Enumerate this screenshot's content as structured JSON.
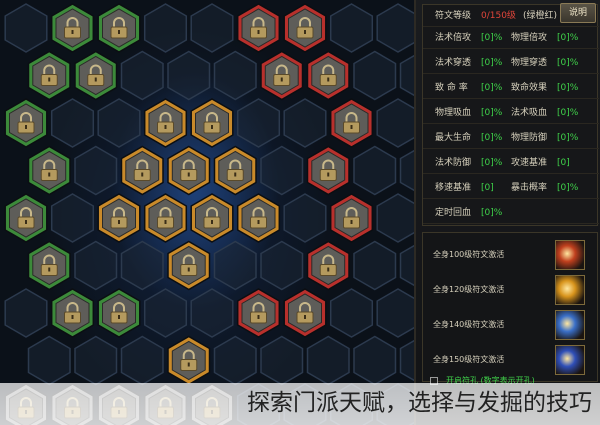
{
  "panel": {
    "help_button": "说明",
    "stats": {
      "header": {
        "label": "符文等级",
        "value": "0/150级",
        "extra": "(绿橙红)"
      },
      "rows": [
        {
          "a_label": "法术倍攻",
          "a_value": "[0]%",
          "b_label": "物理倍攻",
          "b_value": "[0]%"
        },
        {
          "a_label": "法术穿透",
          "a_value": "[0]%",
          "b_label": "物理穿透",
          "b_value": "[0]%"
        },
        {
          "a_label": "致 命 率",
          "a_value": "[0]%",
          "b_label": "致命效果",
          "b_value": "[0]%"
        },
        {
          "a_label": "物理吸血",
          "a_value": "[0]%",
          "b_label": "法术吸血",
          "b_value": "[0]%"
        },
        {
          "a_label": "最大生命",
          "a_value": "[0]%",
          "b_label": "物理防御",
          "b_value": "[0]%"
        },
        {
          "a_label": "法术防御",
          "a_value": "[0]%",
          "b_label": "攻速基准",
          "b_value": "[0]"
        },
        {
          "a_label": "移速基准",
          "a_value": "[0]",
          "b_label": "暴击概率",
          "b_value": "[0]%"
        },
        {
          "a_label": "定时回血",
          "a_value": "[0]%",
          "b_label": "",
          "b_value": ""
        }
      ]
    },
    "activations": [
      {
        "label": "全身100级符文激活",
        "icon": "fire-rune-icon",
        "color": "#c0401e"
      },
      {
        "label": "全身120级符文激活",
        "icon": "flame-rune-icon",
        "color": "#d8941c"
      },
      {
        "label": "全身140级符文激活",
        "icon": "lightning-rune-icon",
        "color": "#3a6fc8"
      },
      {
        "label": "全身150级符文激活",
        "icon": "frost-rune-icon",
        "color": "#2f4fb8"
      }
    ],
    "legend": "开启符孔 (数字表示开孔)"
  },
  "caption": "探索门派天赋，选择与发掘的技巧",
  "board": {
    "colors": {
      "green": "#3c8a3a",
      "red": "#b8302c",
      "gold": "#c98a2a",
      "empty": "#1c2634"
    },
    "locked_slots": [
      {
        "col": 1,
        "row": 0,
        "tier": "green"
      },
      {
        "col": 2,
        "row": 0,
        "tier": "green"
      },
      {
        "col": 5,
        "row": 0,
        "tier": "red"
      },
      {
        "col": 6,
        "row": 0,
        "tier": "red"
      },
      {
        "col": 0,
        "row": 1,
        "tier": "green"
      },
      {
        "col": 1,
        "row": 1,
        "tier": "green"
      },
      {
        "col": 5,
        "row": 1,
        "tier": "red"
      },
      {
        "col": 6,
        "row": 1,
        "tier": "red"
      },
      {
        "col": 0,
        "row": 2,
        "tier": "green"
      },
      {
        "col": 3,
        "row": 2,
        "tier": "gold"
      },
      {
        "col": 4,
        "row": 2,
        "tier": "gold"
      },
      {
        "col": 7,
        "row": 2,
        "tier": "red"
      },
      {
        "col": 0,
        "row": 3,
        "tier": "green"
      },
      {
        "col": 2,
        "row": 3,
        "tier": "gold"
      },
      {
        "col": 3,
        "row": 3,
        "tier": "gold"
      },
      {
        "col": 4,
        "row": 3,
        "tier": "gold"
      },
      {
        "col": 6,
        "row": 3,
        "tier": "red"
      },
      {
        "col": 0,
        "row": 4,
        "tier": "green"
      },
      {
        "col": 2,
        "row": 4,
        "tier": "gold"
      },
      {
        "col": 3,
        "row": 4,
        "tier": "gold"
      },
      {
        "col": 4,
        "row": 4,
        "tier": "gold"
      },
      {
        "col": 5,
        "row": 4,
        "tier": "gold"
      },
      {
        "col": 7,
        "row": 4,
        "tier": "red"
      },
      {
        "col": 0,
        "row": 5,
        "tier": "green"
      },
      {
        "col": 3,
        "row": 5,
        "tier": "gold"
      },
      {
        "col": 6,
        "row": 5,
        "tier": "red"
      },
      {
        "col": 1,
        "row": 6,
        "tier": "green"
      },
      {
        "col": 2,
        "row": 6,
        "tier": "green"
      },
      {
        "col": 5,
        "row": 6,
        "tier": "red"
      },
      {
        "col": 6,
        "row": 6,
        "tier": "red"
      },
      {
        "col": 3,
        "row": 7,
        "tier": "gold"
      },
      {
        "col": 0,
        "row": 8,
        "tier": "grey"
      },
      {
        "col": 1,
        "row": 8,
        "tier": "grey"
      },
      {
        "col": 2,
        "row": 8,
        "tier": "grey"
      },
      {
        "col": 3,
        "row": 8,
        "tier": "grey"
      },
      {
        "col": 4,
        "row": 8,
        "tier": "grey"
      }
    ]
  }
}
